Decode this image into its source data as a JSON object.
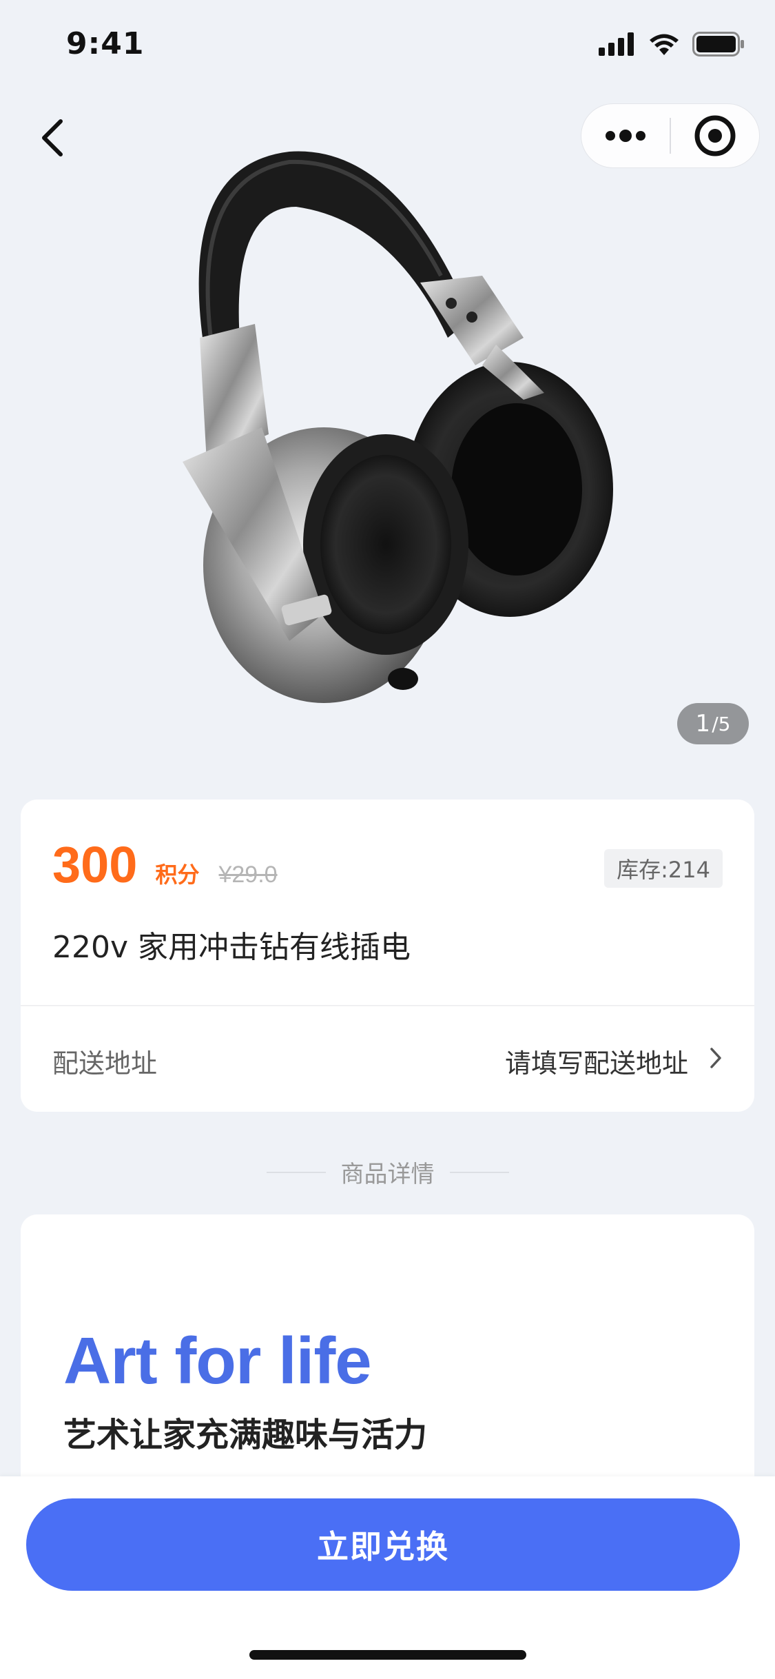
{
  "status_bar": {
    "time": "9:41"
  },
  "nav": {
    "back_icon": "chevron-left-icon",
    "more_icon": "more-dots-icon",
    "close_icon": "target-circle-icon"
  },
  "gallery": {
    "current": "1",
    "total": "/5",
    "image": "headphones-image"
  },
  "product": {
    "price": "300",
    "price_unit": "积分",
    "original_price": "¥29.0",
    "stock": "库存:214",
    "title": "220v 家用冲击钻有线插电"
  },
  "address": {
    "label": "配送地址",
    "placeholder": "请填写配送地址"
  },
  "details": {
    "section_title": "商品详情",
    "banner_en": "Art for life",
    "banner_cn": "艺术让家充满趣味与活力"
  },
  "action": {
    "redeem_label": "立即兑换"
  },
  "colors": {
    "accent": "#4a6ff5",
    "price": "#ff6b1a",
    "background": "#eff2f7",
    "banner_text": "#4a6ee6"
  }
}
